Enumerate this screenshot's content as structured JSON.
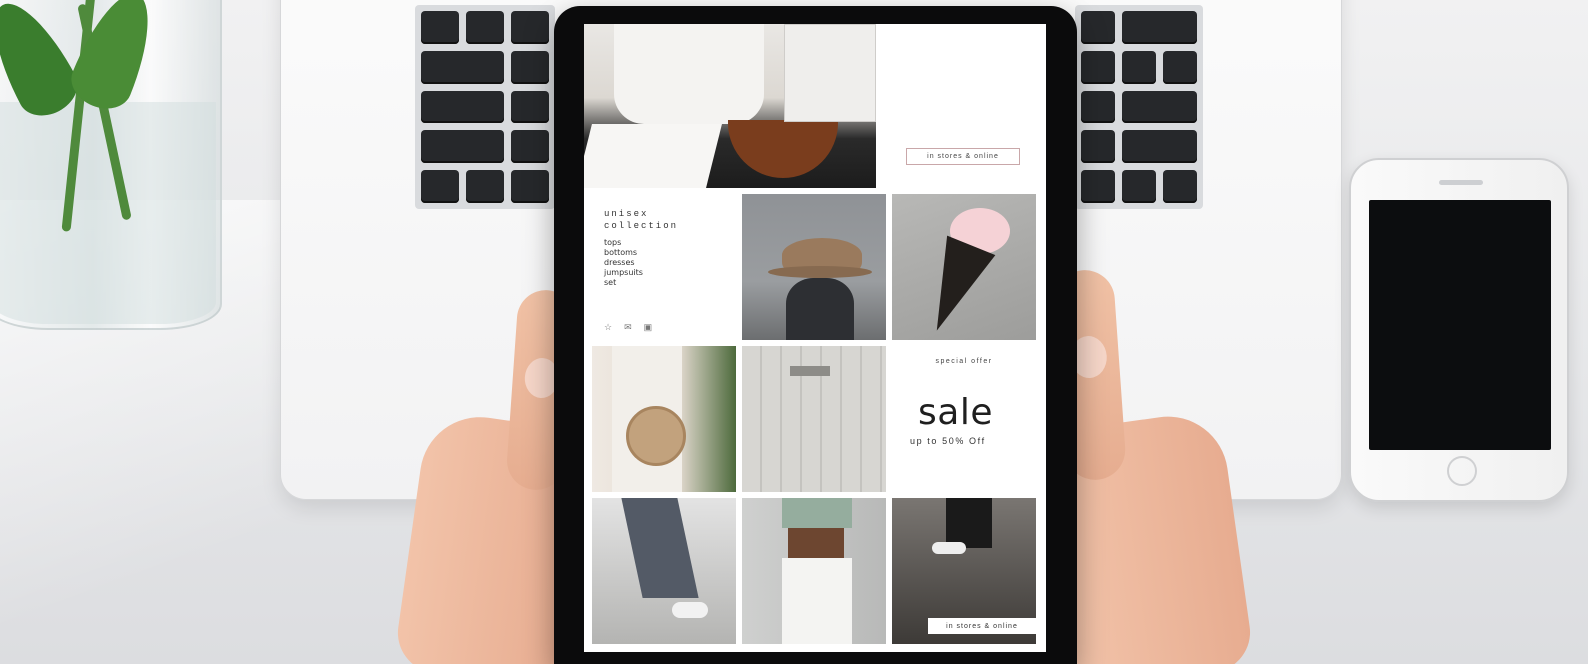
{
  "screen": {
    "banner_cta": "in stores & online",
    "collection": {
      "title_line1": "unisex",
      "title_line2": "collection",
      "items": [
        "tops",
        "bottoms",
        "dresses",
        "jumpsuits",
        "set"
      ]
    },
    "icons": [
      "star-icon",
      "mail-icon",
      "bag-icon"
    ],
    "promo": {
      "eyebrow": "special offer",
      "headline": "sale",
      "subline": "up to 50% Off"
    },
    "footer_cta": "in stores & online"
  },
  "colors": {
    "tablet_bezel": "#0b0b0c",
    "cta_border": "#c9a7a9",
    "text_dark": "#1f1f1f"
  }
}
